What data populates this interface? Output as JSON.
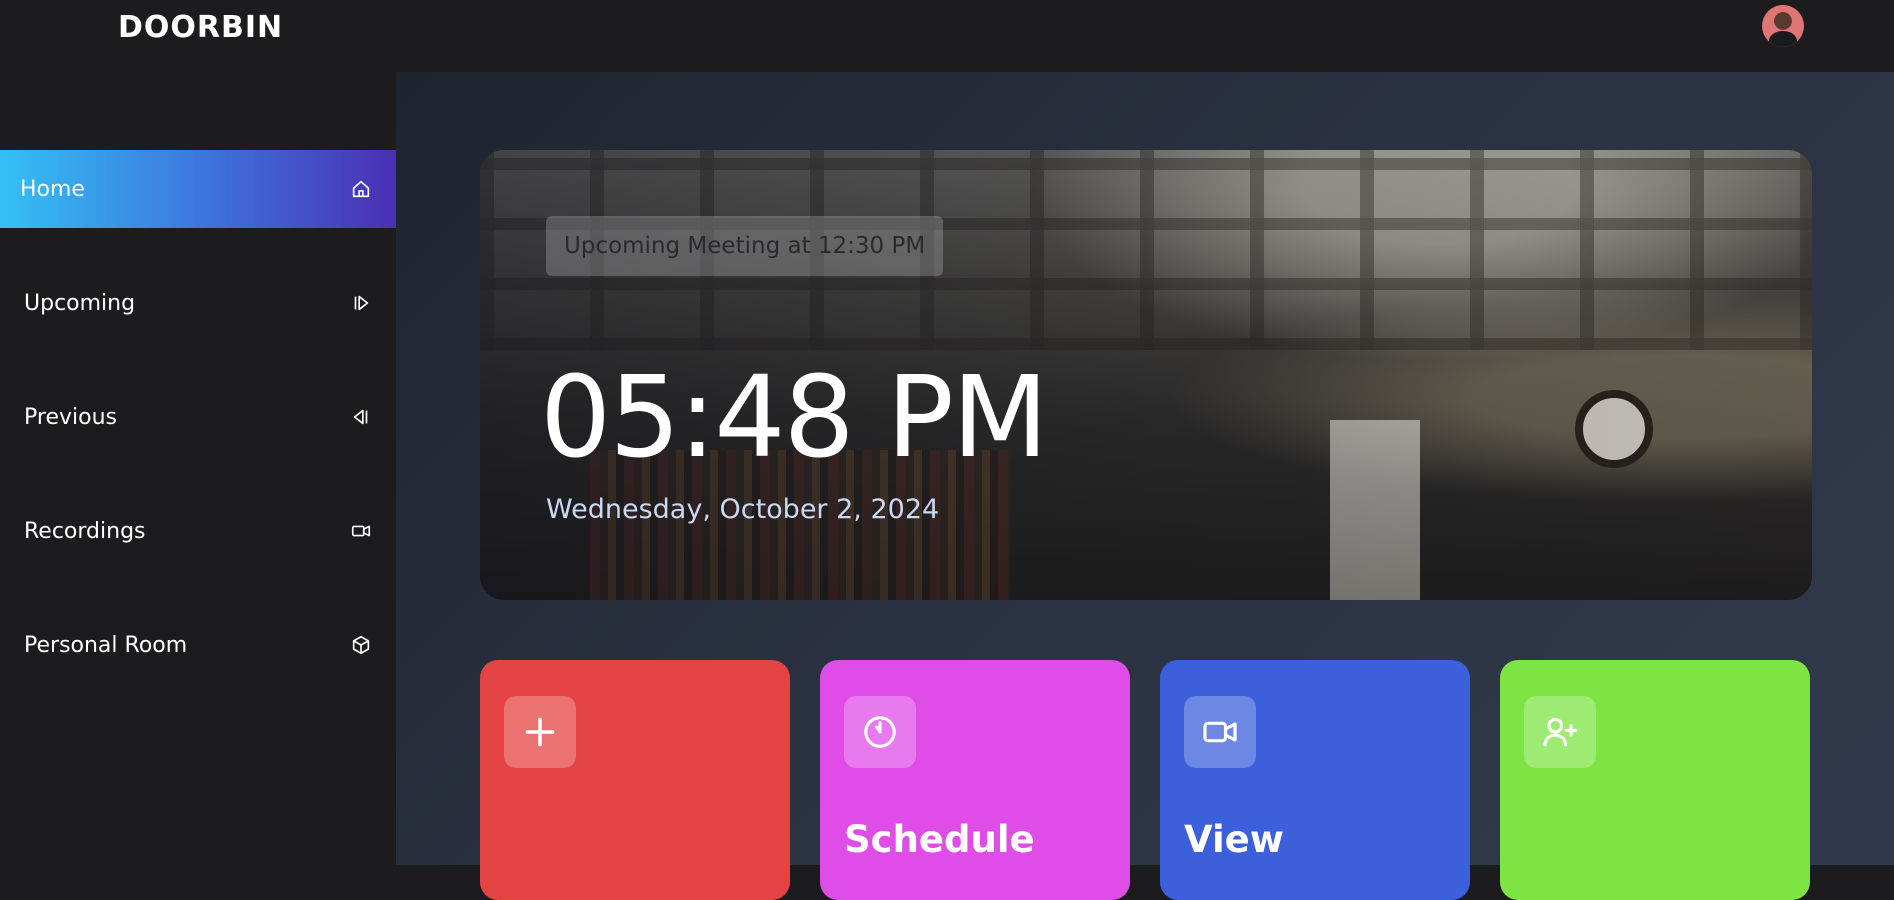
{
  "app": {
    "logo": "DOORBIN"
  },
  "header": {
    "avatar_icon": "user-avatar"
  },
  "sidebar": {
    "items": [
      {
        "label": "Home",
        "icon": "home-icon",
        "active": true
      },
      {
        "label": "Upcoming",
        "icon": "forward-step-icon",
        "active": false
      },
      {
        "label": "Previous",
        "icon": "back-step-icon",
        "active": false
      },
      {
        "label": "Recordings",
        "icon": "video-icon",
        "active": false
      },
      {
        "label": "Personal Room",
        "icon": "cube-icon",
        "active": false
      }
    ],
    "active_gradient": [
      "#35c0f5",
      "#4a2fb4"
    ]
  },
  "hero": {
    "meeting_text": "Upcoming Meeting at 12:30 PM",
    "time": "05:48 PM",
    "date": "Wednesday, October 2, 2024"
  },
  "cards": [
    {
      "title": "",
      "icon": "plus-icon",
      "color": "#e34341"
    },
    {
      "title": "Schedule",
      "icon": "clock-icon",
      "color": "#e04ce8"
    },
    {
      "title": "View",
      "icon": "video-icon",
      "color": "#3c5fdc"
    },
    {
      "title": "",
      "icon": "add-user-icon",
      "color": "#7de444"
    }
  ]
}
